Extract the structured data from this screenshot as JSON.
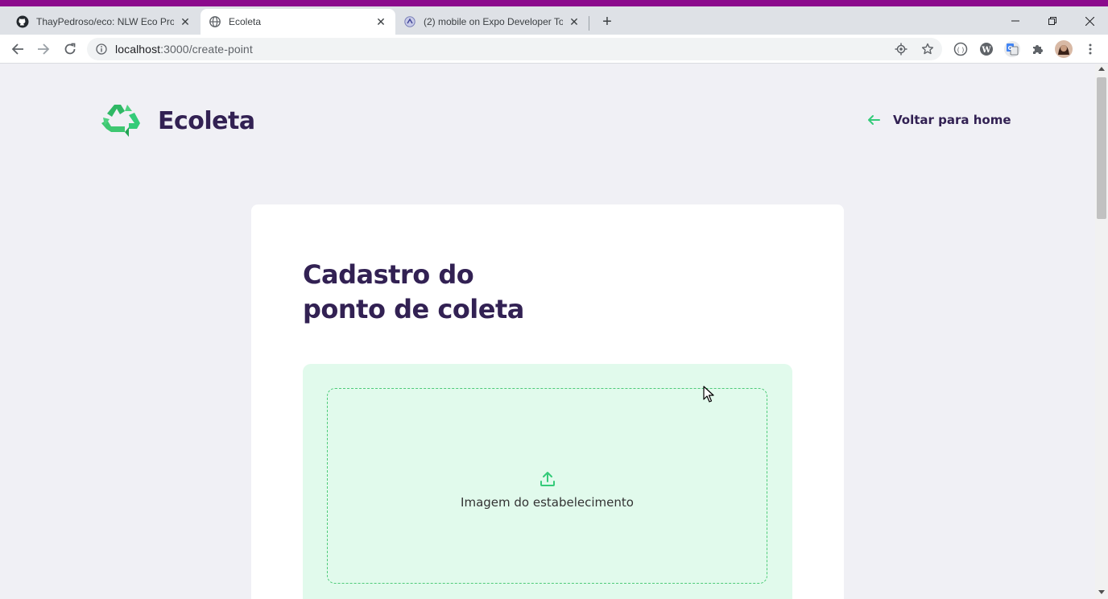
{
  "browser": {
    "tabs": [
      {
        "title": "ThayPedroso/eco: NLW Eco Proje",
        "icon": "github-icon",
        "active": false
      },
      {
        "title": "Ecoleta",
        "icon": "globe-icon",
        "active": true
      },
      {
        "title": "(2) mobile on Expo Developer To",
        "icon": "expo-icon",
        "active": false
      }
    ],
    "url_host": "localhost",
    "url_path": ":3000/create-point"
  },
  "header": {
    "brand": "Ecoleta",
    "back_link": "Voltar para home"
  },
  "form": {
    "title_line1": "Cadastro do",
    "title_line2": "ponto de coleta",
    "dropzone_label": "Imagem do estabelecimento"
  },
  "colors": {
    "brand_primary": "#322153",
    "accent_green": "#34cb79",
    "page_bg": "#f0f0f5",
    "dropzone_bg": "#e1faec"
  }
}
